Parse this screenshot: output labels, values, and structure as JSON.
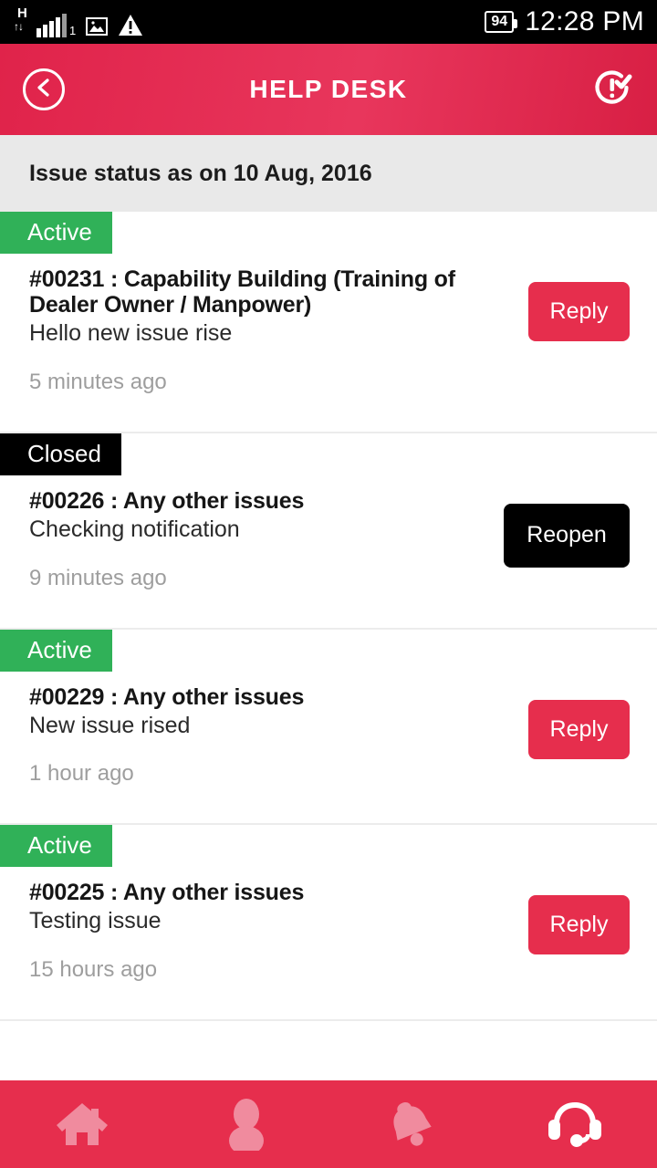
{
  "statusbar": {
    "network_type": "H",
    "sim_number": "1",
    "signal_icon": "signal-bars-icon",
    "data_arrows_icon": "data-transfer-icon",
    "gallery_icon": "image-icon",
    "warning_icon": "warning-triangle-icon",
    "battery_level": "94",
    "time": "12:28 PM"
  },
  "header": {
    "title": "HELP DESK",
    "back_icon": "chevron-left-icon",
    "raise_issue_icon": "issue-check-icon"
  },
  "subheader": {
    "text": "Issue status as on 10 Aug, 2016"
  },
  "colors": {
    "accent_red": "#e62e4d",
    "header_red": "#e0234a",
    "active_green": "#30b158",
    "closed_black": "#000000",
    "subheader_gray": "#e9e9e9",
    "time_gray": "#9e9e9e"
  },
  "issues": [
    {
      "status": "Active",
      "status_type": "active",
      "title": "#00231 : Capability Building (Training of Dealer Owner / Manpower)",
      "description": "Hello new issue rise",
      "time": "5 minutes ago",
      "action_label": "Reply",
      "action_type": "reply"
    },
    {
      "status": "Closed",
      "status_type": "closed",
      "title": "#00226 : Any other issues",
      "description": "Checking notification",
      "time": "9 minutes ago",
      "action_label": "Reopen",
      "action_type": "reopen"
    },
    {
      "status": "Active",
      "status_type": "active",
      "title": "#00229 : Any other issues",
      "description": "New issue rised",
      "time": "1 hour ago",
      "action_label": "Reply",
      "action_type": "reply"
    },
    {
      "status": "Active",
      "status_type": "active",
      "title": "#00225 : Any other issues",
      "description": "Testing issue",
      "time": "15 hours ago",
      "action_label": "Reply",
      "action_type": "reply"
    }
  ],
  "bottomnav": {
    "items": [
      {
        "icon": "home-icon",
        "label": "Home",
        "active": false
      },
      {
        "icon": "profile-icon",
        "label": "Profile",
        "active": false
      },
      {
        "icon": "bell-icon",
        "label": "Notifications",
        "active": false
      },
      {
        "icon": "headset-icon",
        "label": "Support",
        "active": true
      }
    ]
  }
}
